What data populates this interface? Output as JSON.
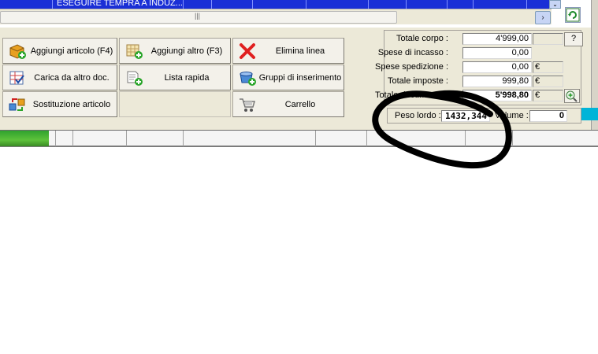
{
  "grid": {
    "row_text": "ESEGUIRE TEMPRA A INDUZ..."
  },
  "scrollbar": {
    "grip": "|||",
    "right_arrow": "›",
    "down_arrow": "⌄"
  },
  "buttons": {
    "aggiungi_articolo": "Aggiungi articolo (F4)",
    "aggiungi_altro": "Aggiungi altro (F3)",
    "elimina_linea": "Elimina linea",
    "carica_da_altro": "Carica da altro doc.",
    "lista_rapida": "Lista rapida",
    "gruppi_inserimento": "Gruppi di inserimento",
    "sostituzione_articolo": "Sostituzione articolo",
    "carrello": "Carrello"
  },
  "totals": {
    "totale_corpo_label": "Totale corpo :",
    "totale_corpo_value": "4'999,00",
    "spese_incasso_label": "Spese di incasso :",
    "spese_incasso_value": "0,00",
    "spese_spedizione_label": "Spese spedizione :",
    "spese_spedizione_value": "0,00",
    "spese_spedizione_currency": "€",
    "totale_imposte_label": "Totale imposte :",
    "totale_imposte_value": "999,80",
    "totale_imposte_currency": "€",
    "totale_documento_label": "Totale documento :",
    "totale_documento_value": "5'998,80",
    "totale_documento_currency": "€",
    "help_label": "?"
  },
  "weight": {
    "peso_lordo_label": "Peso lordo :",
    "peso_lordo_value": "1432,344",
    "volume_label": "Volume :",
    "volume_value": "0"
  },
  "colors": {
    "grid_blue": "#1a2fd6",
    "panel_bg": "#ece9d8",
    "ink": "#000000"
  }
}
